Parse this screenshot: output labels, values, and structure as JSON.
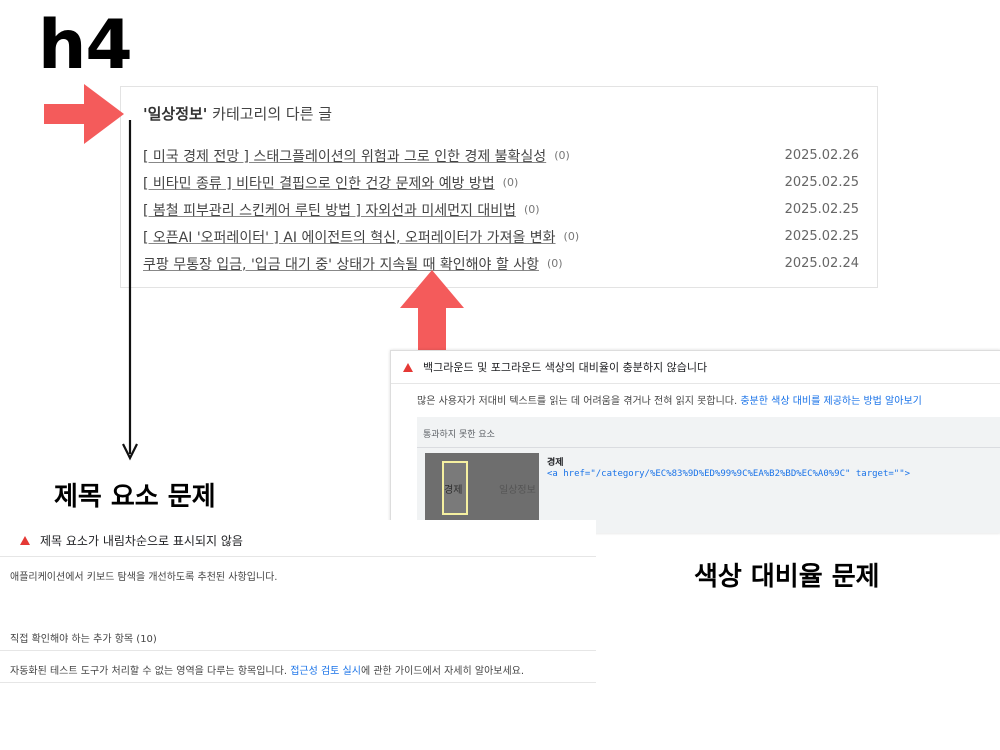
{
  "annotations": {
    "h4_label": "h4",
    "heading_issue_label": "제목 요소 문제",
    "contrast_issue_label": "색상 대비율 문제"
  },
  "colors": {
    "arrow_red": "#f45b5b",
    "warn_red": "#e53935",
    "link_blue": "#1a73e8"
  },
  "related_posts": {
    "heading_category": "'일상정보'",
    "heading_suffix": " 카테고리의 다른 글",
    "items": [
      {
        "title": "[ 미국 경제 전망 ] 스태그플레이션의 위험과 그로 인한 경제 불확실성",
        "count": "(0)",
        "date": "2025.02.26"
      },
      {
        "title": "[ 비타민 종류 ] 비타민 결핍으로 인한 건강 문제와 예방 방법",
        "count": "(0)",
        "date": "2025.02.25"
      },
      {
        "title": "[ 봄철 피부관리 스킨케어 루틴 방법 ] 자외선과 미세먼지 대비법",
        "count": "(0)",
        "date": "2025.02.25"
      },
      {
        "title": "[ 오픈AI '오퍼레이터' ] AI 에이전트의 혁신, 오퍼레이터가 가져올 변화",
        "count": "(0)",
        "date": "2025.02.25"
      },
      {
        "title": "쿠팡 무통장 입금, '입금 대기 중' 상태가 지속될 때 확인해야 할 사항",
        "count": "(0)",
        "date": "2025.02.24"
      }
    ]
  },
  "contrast_audit": {
    "title": "백그라운드 및 포그라운드 색상의 대비율이 충분하지 않습니다",
    "description": "많은 사용자가 저대비 텍스트를 읽는 데 어려움을 겪거나 전혀 읽지 못합니다. ",
    "description_link": "충분한 색상 대비를 제공하는 방법 알아보기",
    "failed_elements_label": "통과하지 못한 요소",
    "thumb_text_highlight": "경제",
    "thumb_text_other": "일상정보",
    "node_label": "경제",
    "node_snippet": "<a href=\"/category/%EC%83%9D%ED%99%9C%EA%B2%BD%EC%A0%9C\" target=\"\">"
  },
  "heading_audit": {
    "title": "제목 요소가 내림차순으로 표시되지 않음",
    "description": "애플리케이션에서 키보드 탐색을 개선하도록 추천된 사항입니다.",
    "manual_check_label": "직접 확인해야 하는 추가 항목 (10)",
    "manual_desc_prefix": "자동화된 테스트 도구가 처리할 수 없는 영역을 다루는 항목입니다. ",
    "manual_desc_link": "접근성 검토 실시",
    "manual_desc_suffix": "에 관한 가이드에서 자세히 알아보세요."
  }
}
